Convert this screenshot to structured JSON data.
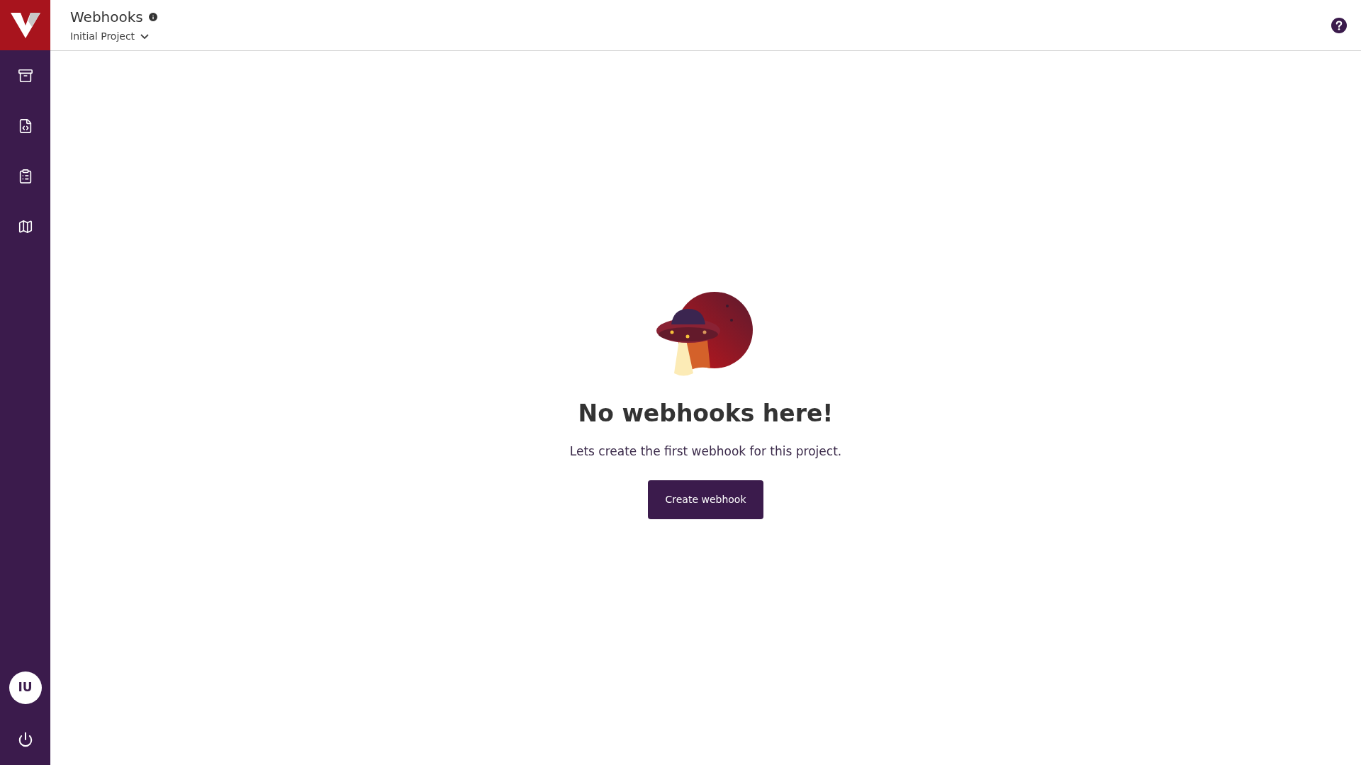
{
  "header": {
    "title": "Webhooks",
    "project": "Initial Project"
  },
  "sidebar": {
    "items": [
      {
        "kind": "archive"
      },
      {
        "kind": "code-file"
      },
      {
        "kind": "checklist"
      },
      {
        "kind": "map"
      }
    ],
    "avatar": "IU"
  },
  "empty_state": {
    "heading": "No webhooks here!",
    "message": "Lets create the first webhook for this project.",
    "button": "Create webhook"
  }
}
